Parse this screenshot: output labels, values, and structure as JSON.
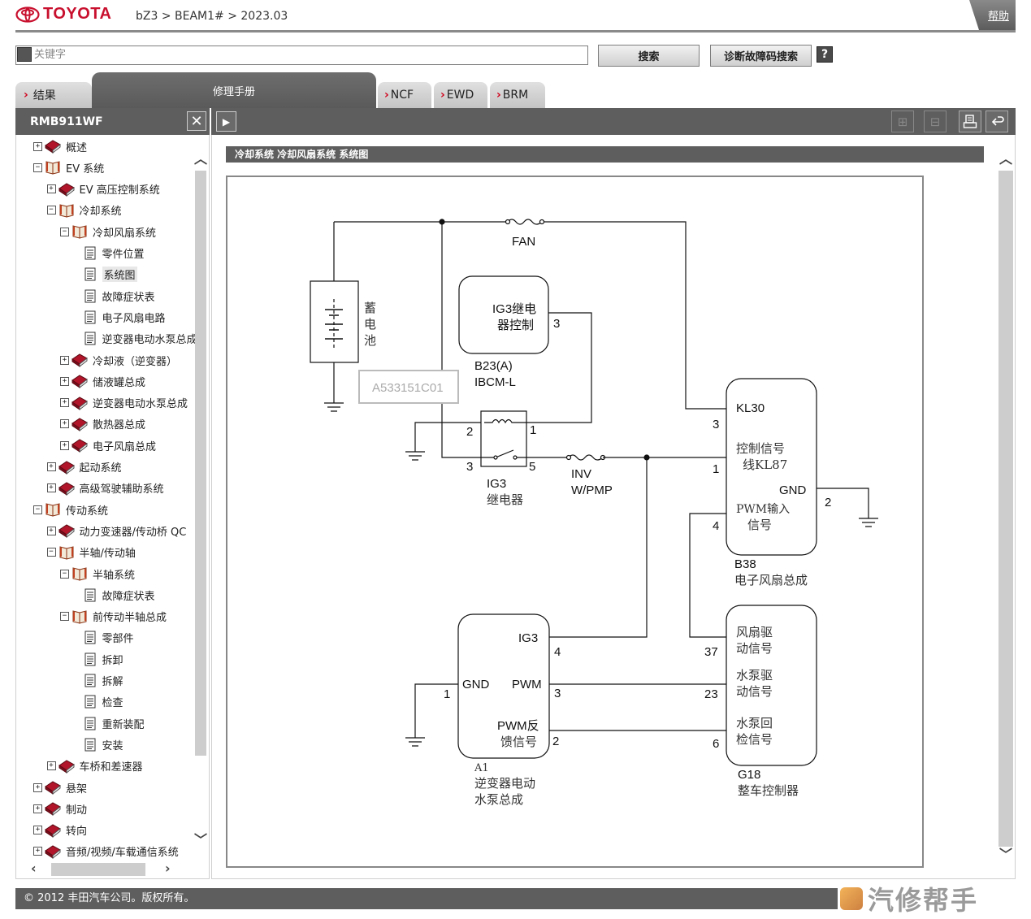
{
  "header": {
    "brand": "TOYOTA",
    "breadcrumb": "bZ3 > BEAM1# > 2023.03",
    "help_label": "帮助"
  },
  "search": {
    "placeholder": "关键字",
    "search_button": "搜索",
    "dtc_search_button": "诊断故障码搜索",
    "help_icon_label": "?"
  },
  "tabs": {
    "results": "结果",
    "manual": "修理手册",
    "ncf": "NCF",
    "ewd": "EWD",
    "brm": "BRM"
  },
  "left_panel": {
    "title": "RMB911WF",
    "close_label": "✕"
  },
  "tree": [
    {
      "label": "概述",
      "toggle": "+",
      "icon": "book-closed-icon",
      "level": 0
    },
    {
      "label": "EV 系统",
      "toggle": "-",
      "icon": "book-open-icon",
      "level": 0
    },
    {
      "label": "EV 高压控制系统",
      "toggle": "+",
      "icon": "book-closed-icon",
      "level": 1
    },
    {
      "label": "冷却系统",
      "toggle": "-",
      "icon": "book-open-icon",
      "level": 1
    },
    {
      "label": "冷却风扇系统",
      "toggle": "-",
      "icon": "book-open-icon",
      "level": 2
    },
    {
      "label": "零件位置",
      "toggle": "",
      "icon": "document-icon",
      "level": 3
    },
    {
      "label": "系统图",
      "toggle": "",
      "icon": "document-icon",
      "level": 3,
      "selected": true
    },
    {
      "label": "故障症状表",
      "toggle": "",
      "icon": "document-icon",
      "level": 3
    },
    {
      "label": "电子风扇电路",
      "toggle": "",
      "icon": "document-icon",
      "level": 3
    },
    {
      "label": "逆变器电动水泵总成",
      "toggle": "",
      "icon": "document-icon",
      "level": 3
    },
    {
      "label": "冷却液（逆变器）",
      "toggle": "+",
      "icon": "book-closed-icon",
      "level": 2
    },
    {
      "label": "储液罐总成",
      "toggle": "+",
      "icon": "book-closed-icon",
      "level": 2
    },
    {
      "label": "逆变器电动水泵总成",
      "toggle": "+",
      "icon": "book-closed-icon",
      "level": 2
    },
    {
      "label": "散热器总成",
      "toggle": "+",
      "icon": "book-closed-icon",
      "level": 2
    },
    {
      "label": "电子风扇总成",
      "toggle": "+",
      "icon": "book-closed-icon",
      "level": 2
    },
    {
      "label": "起动系统",
      "toggle": "+",
      "icon": "book-closed-icon",
      "level": 1
    },
    {
      "label": "高级驾驶辅助系统",
      "toggle": "+",
      "icon": "book-closed-icon",
      "level": 1
    },
    {
      "label": "传动系统",
      "toggle": "-",
      "icon": "book-open-icon",
      "level": 0
    },
    {
      "label": "动力变速器/传动桥 QC",
      "toggle": "+",
      "icon": "book-closed-icon",
      "level": 1
    },
    {
      "label": "半轴/传动轴",
      "toggle": "-",
      "icon": "book-open-icon",
      "level": 1
    },
    {
      "label": "半轴系统",
      "toggle": "-",
      "icon": "book-open-icon",
      "level": 2
    },
    {
      "label": "故障症状表",
      "toggle": "",
      "icon": "document-icon",
      "level": 3
    },
    {
      "label": "前传动半轴总成",
      "toggle": "-",
      "icon": "book-open-icon",
      "level": 2
    },
    {
      "label": "零部件",
      "toggle": "",
      "icon": "document-icon",
      "level": 3
    },
    {
      "label": "拆卸",
      "toggle": "",
      "icon": "document-icon",
      "level": 3
    },
    {
      "label": "拆解",
      "toggle": "",
      "icon": "document-icon",
      "level": 3
    },
    {
      "label": "检查",
      "toggle": "",
      "icon": "document-icon",
      "level": 3
    },
    {
      "label": "重新装配",
      "toggle": "",
      "icon": "document-icon",
      "level": 3
    },
    {
      "label": "安装",
      "toggle": "",
      "icon": "document-icon",
      "level": 3
    },
    {
      "label": "车桥和差速器",
      "toggle": "+",
      "icon": "book-closed-icon",
      "level": 1
    },
    {
      "label": "悬架",
      "toggle": "+",
      "icon": "book-closed-icon",
      "level": 0
    },
    {
      "label": "制动",
      "toggle": "+",
      "icon": "book-closed-icon",
      "level": 0
    },
    {
      "label": "转向",
      "toggle": "+",
      "icon": "book-closed-icon",
      "level": 0
    },
    {
      "label": "音频/视频/车载通信系统",
      "toggle": "+",
      "icon": "book-closed-icon",
      "level": 0
    }
  ],
  "content": {
    "section_title": "冷却系统  冷却风扇系统  系统图",
    "diagram": {
      "image_id_label": "A533151C01",
      "fuse_fan": "FAN",
      "battery_l1": "蓄",
      "battery_l2": "电",
      "battery_l3": "池",
      "ig3_relay_ctrl_l1": "IG3继电",
      "ig3_relay_ctrl_l2": "器控制",
      "ibcm_pin": "3",
      "ibcm_code": "B23(A)",
      "ibcm_name": "IBCM-L",
      "relay_pin2": "2",
      "relay_pin1": "1",
      "relay_pin3": "3",
      "relay_pin5": "5",
      "relay_name_l1": "IG3",
      "relay_name_l2": "继电器",
      "fuse_inv_l1": "INV",
      "fuse_inv_l2": "W/PMP",
      "fan_kl30": "KL30",
      "fan_pin3": "3",
      "fan_ctrl_l1": "控制信号",
      "fan_ctrl_l2": "线KL87",
      "fan_pin1": "1",
      "fan_gnd": "GND",
      "fan_pin2": "2",
      "fan_pwm_l1": "PWM输入",
      "fan_pwm_l2": "信号",
      "fan_pin4": "4",
      "fan_code": "B38",
      "fan_name": "电子风扇总成",
      "pump_ig3": "IG3",
      "pump_pin4": "4",
      "pump_gnd": "GND",
      "pump_pin1": "1",
      "pump_pwm": "PWM",
      "pump_pin3": "3",
      "pump_fb_l1": "PWM反",
      "pump_fb_l2": "馈信号",
      "pump_pin2": "2",
      "pump_code": "A1",
      "pump_name_l1": "逆变器电动",
      "pump_name_l2": "水泵总成",
      "ecu_fan_l1": "风扇驱",
      "ecu_fan_l2": "动信号",
      "ecu_pin37": "37",
      "ecu_pump_l1": "水泵驱",
      "ecu_pump_l2": "动信号",
      "ecu_pin23": "23",
      "ecu_chk_l1": "水泵回",
      "ecu_chk_l2": "检信号",
      "ecu_pin6": "6",
      "ecu_code": "G18",
      "ecu_name": "整车控制器"
    }
  },
  "footer": {
    "copyright": "© 2012 丰田汽车公司。版权所有。",
    "watermark": "汽修帮手"
  },
  "colors": {
    "brand_red": "#c8102e",
    "toolbar_gray": "#5e5e5e",
    "tab_chevron_red": "#d0021b"
  }
}
